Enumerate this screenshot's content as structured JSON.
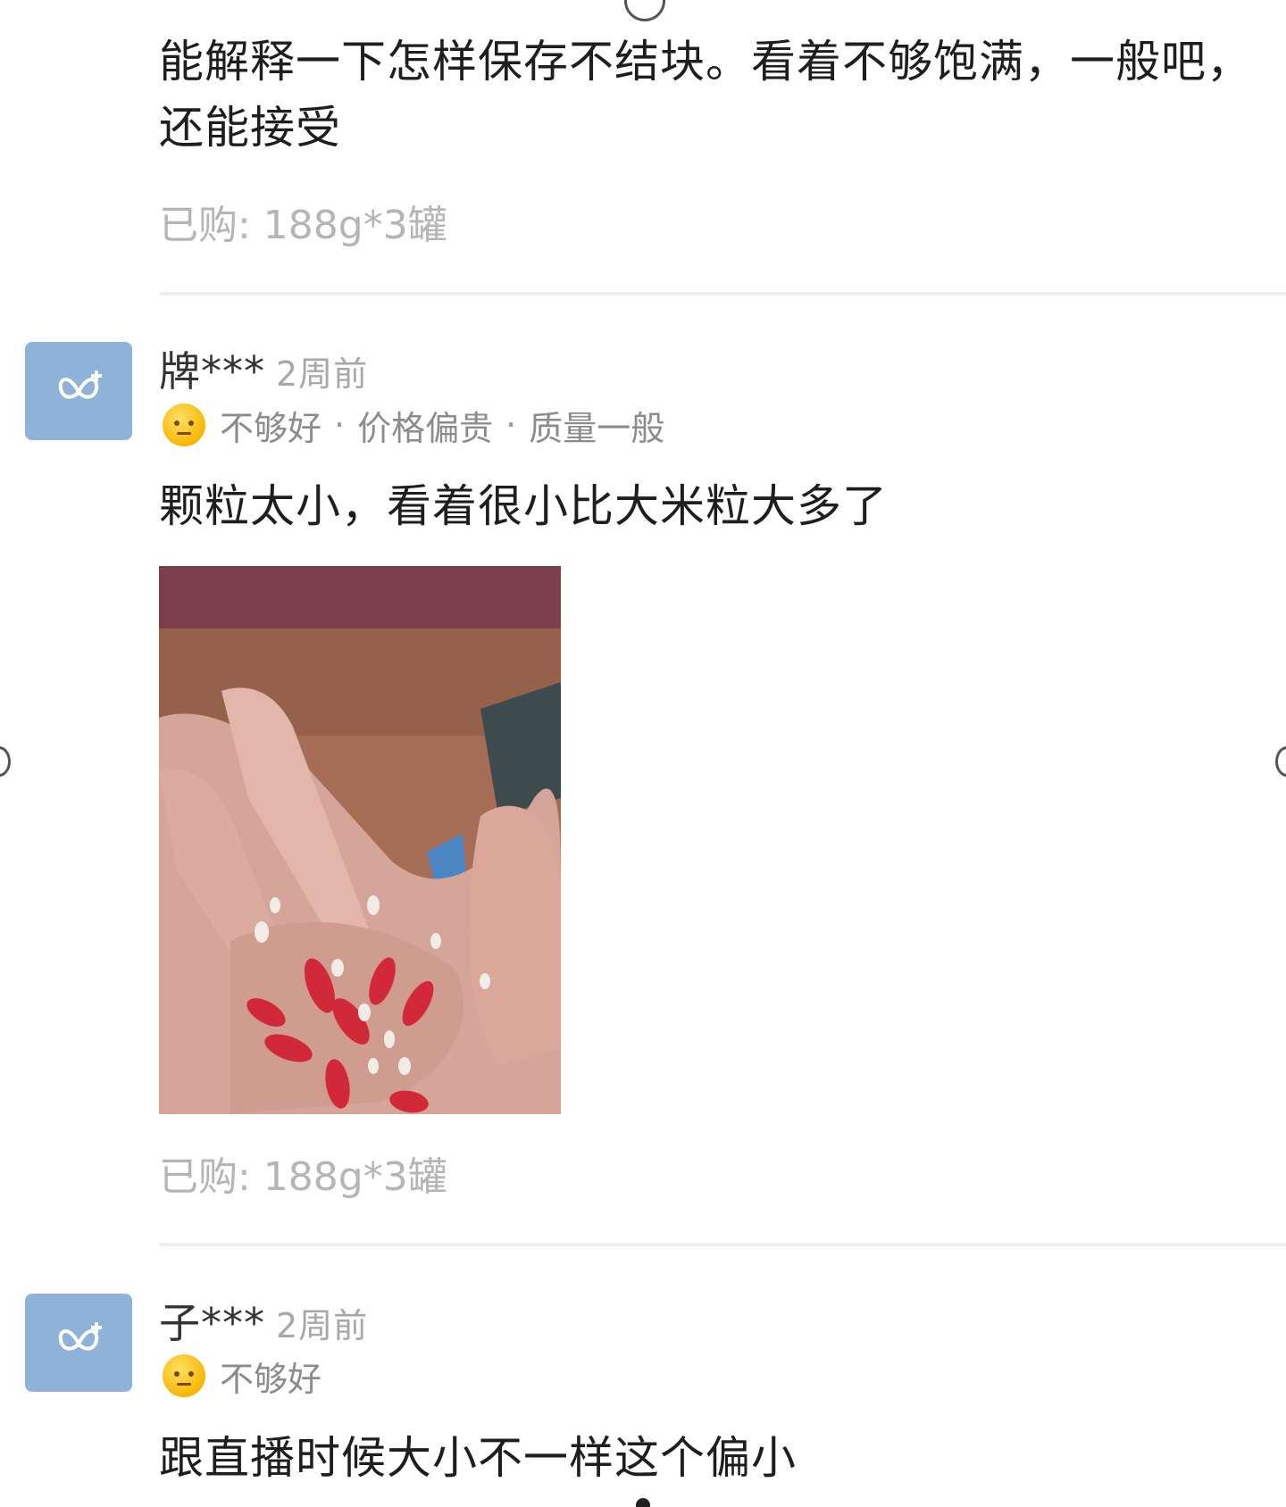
{
  "reviews": [
    {
      "content": "能解释一下怎样保存不结块。看着不够饱满，一般吧，还能接受",
      "purchased": "已购: 188g*3罐"
    },
    {
      "username": "牌***",
      "time": "2周前",
      "rating": "不够好",
      "tags": [
        "价格偏贵",
        "质量一般"
      ],
      "content": "颗粒太小，看着很小比大米粒大多了",
      "purchased": "已购: 188g*3罐"
    },
    {
      "username": "子***",
      "time": "2周前",
      "rating": "不够好",
      "content": "跟直播时候大小不一样这个偏小"
    }
  ],
  "tag_separator": "·",
  "colors": {
    "avatar_bg": "#8fb2d8",
    "rating_emoji": "#f5b400",
    "muted_text": "#b5b5b5"
  },
  "icons": {
    "avatar": "butterfly-icon",
    "rating": "neutral-face-emoji-icon"
  }
}
